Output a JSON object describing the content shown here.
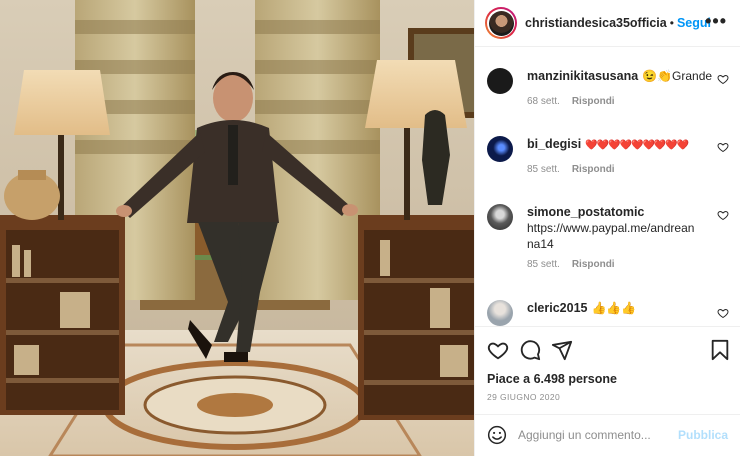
{
  "post": {
    "photo_icon": "photo",
    "author": {
      "username": "christiandesica35officia",
      "separator": "•",
      "follow_label": "Segui",
      "more_icon": "more-horizontal-icon",
      "more_label": "•••"
    }
  },
  "comments": [
    {
      "username": "manzinikitasusana",
      "text": "😉👏Grande",
      "time": "68 sett.",
      "reply_label": "Rispondi",
      "avatar_color": "#1a1a1a"
    },
    {
      "username": "bi_degisi",
      "text": "❤️❤️❤️❤️❤️❤️❤️❤️❤️",
      "time": "85 sett.",
      "reply_label": "Rispondi",
      "avatar_color": "#0c1a4a"
    },
    {
      "username": "simone_postatomic",
      "text": "https://www.paypal.me/andreanna14",
      "time": "85 sett.",
      "reply_label": "Rispondi",
      "avatar_color": "#5a5a5a"
    },
    {
      "username": "cleric2015",
      "text": "👍👍👍",
      "time": "",
      "reply_label": "",
      "avatar_color": "#9aa4ad"
    }
  ],
  "actions": {
    "like_icon": "heart-icon",
    "comment_icon": "comment-icon",
    "share_icon": "share-icon",
    "save_icon": "bookmark-icon"
  },
  "likes_text": "Piace a 6.498 persone",
  "date_text": "29 GIUGNO 2020",
  "add_comment": {
    "emoji_icon": "emoji-icon",
    "placeholder": "Aggiungi un commento...",
    "publish_label": "Pubblica"
  },
  "colors": {
    "link_blue": "#0095f6",
    "publish_disabled": "#b2dffc",
    "heart_red": "#ed4956",
    "meta_grey": "#8e8e8e"
  }
}
